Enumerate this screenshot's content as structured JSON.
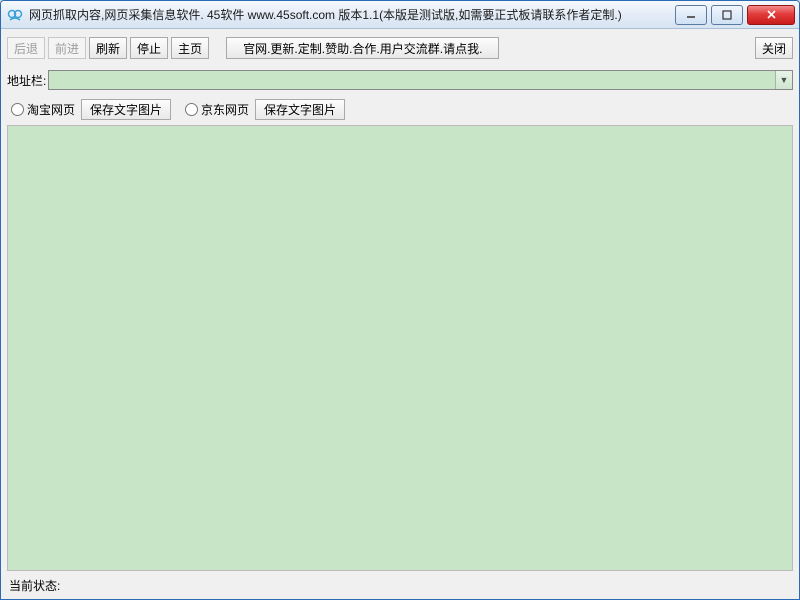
{
  "window": {
    "title": "网页抓取内容,网页采集信息软件. 45软件 www.45soft.com 版本1.1(本版是测试版,如需要正式板请联系作者定制.)"
  },
  "toolbar": {
    "back": "后退",
    "forward": "前进",
    "refresh": "刷新",
    "stop": "停止",
    "home": "主页",
    "promo": "官网.更新.定制.赞助.合作.用户交流群.请点我.",
    "close": "关闭"
  },
  "address": {
    "label": "地址栏:",
    "value": ""
  },
  "options": {
    "taobao": "淘宝网页",
    "save_text_img_1": "保存文字图片",
    "jingdong": "京东网页",
    "save_text_img_2": "保存文字图片"
  },
  "status": {
    "label": "当前状态:",
    "value": ""
  }
}
